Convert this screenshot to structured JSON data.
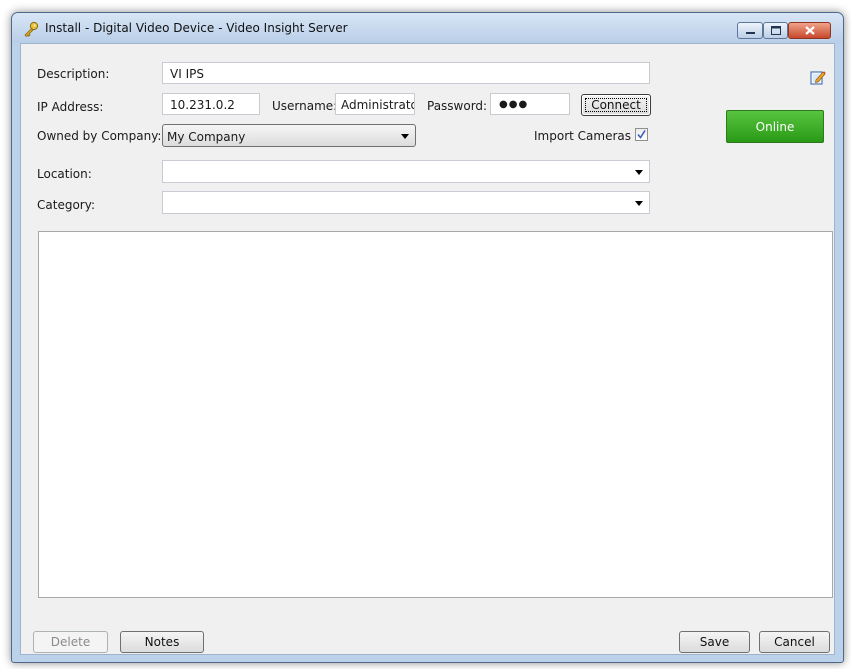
{
  "window": {
    "title": "Install - Digital Video Device - Video Insight Server",
    "controls": [
      "minimize",
      "maximize",
      "close"
    ]
  },
  "form": {
    "description_label": "Description:",
    "description_value": "VI IPS",
    "ip_label": "IP Address:",
    "ip_value": "10.231.0.2",
    "username_label": "Username:",
    "username_value": "Administrator",
    "password_label": "Password:",
    "password_mask": "●●●",
    "connect_label": "Connect",
    "owned_label": "Owned by Company:",
    "owned_value": "My Company",
    "import_cameras_label": "Import Cameras",
    "import_cameras_checked": true,
    "location_label": "Location:",
    "location_value": "",
    "category_label": "Category:",
    "category_value": ""
  },
  "status": {
    "online_label": "Online",
    "online_color": "#2e9e1a"
  },
  "icons": {
    "app": "key-icon",
    "edit": "edit-icon"
  },
  "footer": {
    "delete_label": "Delete",
    "notes_label": "Notes",
    "save_label": "Save",
    "cancel_label": "Cancel"
  }
}
